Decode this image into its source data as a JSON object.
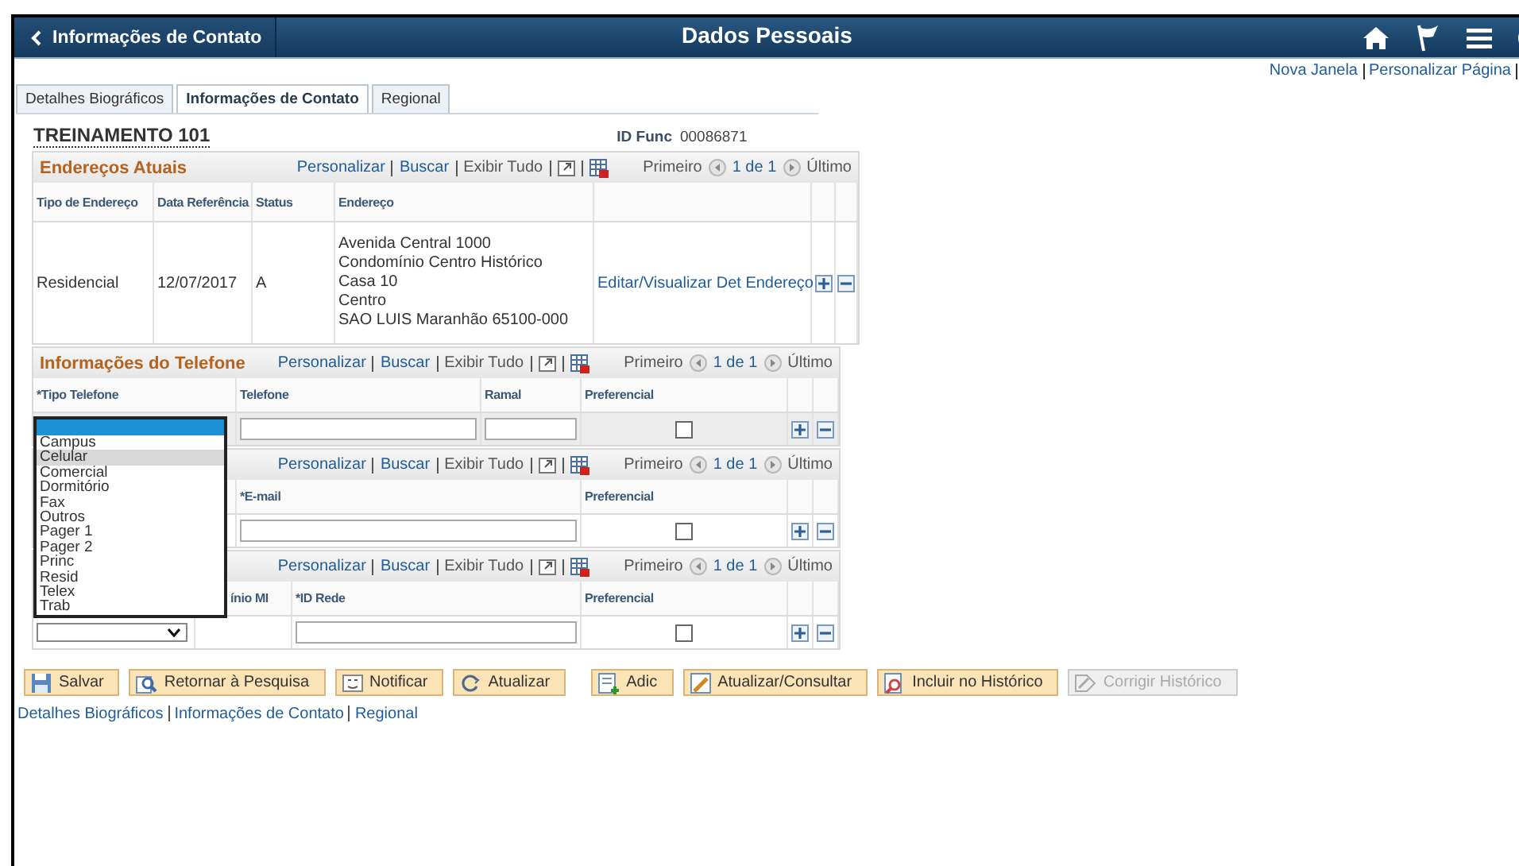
{
  "header": {
    "back_label": "Informações de Contato",
    "title": "Dados Pessoais"
  },
  "page_links": [
    "Nova Janela",
    "Personalizar Página"
  ],
  "tabs": [
    {
      "label": "Detalhes Biográficos",
      "selected": false
    },
    {
      "label": "Informações de Contato",
      "selected": true
    },
    {
      "label": "Regional",
      "selected": false
    }
  ],
  "employee": {
    "name": "TREINAMENTO 101",
    "id_label": "ID Func",
    "id_value": "00086871"
  },
  "sections": [
    {
      "title": "Endereços Atuais",
      "toolbar": {
        "customize": "Personalizar",
        "find": "Buscar",
        "view_all": "Exibir Tudo",
        "first": "Primeiro",
        "range": "1 de 1",
        "last": "Último"
      },
      "columns": [
        "Tipo de Endereço",
        "Data Referência",
        "Status",
        "Endereço"
      ],
      "rows": [
        {
          "highlighted": false,
          "cells": [
            {
              "kind": "text",
              "text": "Residencial"
            },
            {
              "kind": "text",
              "text": "12/07/2017"
            },
            {
              "kind": "text",
              "text": "A"
            },
            {
              "kind": "lines",
              "lines": [
                "Avenida Central 1000",
                "Condomínio Centro Histórico",
                "Casa 10",
                "Centro",
                "SAO LUIS Maranhão 65100-000"
              ]
            },
            {
              "kind": "link",
              "text": "Editar/Visualizar Det Endereço"
            },
            {
              "kind": "add"
            },
            {
              "kind": "remove"
            }
          ]
        }
      ]
    },
    {
      "title": "Informações do Telefone",
      "toolbar": {
        "customize": "Personalizar",
        "find": "Buscar",
        "view_all": "Exibir Tudo",
        "first": "Primeiro",
        "range": "1 de 1",
        "last": "Último"
      },
      "columns": [
        "*Tipo Telefone",
        "Telefone",
        "Ramal",
        "Preferencial"
      ],
      "rows": [
        {
          "highlighted": true,
          "cells": [
            {
              "kind": "select",
              "open": true,
              "blank_selected": true,
              "options": [
                {
                  "label": "Campus",
                  "highlighted": false
                },
                {
                  "label": "Celular",
                  "highlighted": true
                },
                {
                  "label": "Comercial",
                  "highlighted": false
                },
                {
                  "label": "Dormitório",
                  "highlighted": false
                },
                {
                  "label": "Fax",
                  "highlighted": false
                },
                {
                  "label": "Outros",
                  "highlighted": false
                },
                {
                  "label": "Pager 1",
                  "highlighted": false
                },
                {
                  "label": "Pager 2",
                  "highlighted": false
                },
                {
                  "label": "Princ",
                  "highlighted": false
                },
                {
                  "label": "Resid",
                  "highlighted": false
                },
                {
                  "label": "Telex",
                  "highlighted": false
                },
                {
                  "label": "Trab",
                  "highlighted": false
                }
              ]
            },
            {
              "kind": "input"
            },
            {
              "kind": "input"
            },
            {
              "kind": "checkbox",
              "checked": false
            },
            {
              "kind": "add"
            },
            {
              "kind": "remove"
            }
          ]
        }
      ]
    },
    {
      "toolbar": {
        "customize": "Personalizar",
        "find": "Buscar",
        "view_all": "Exibir Tudo",
        "first": "Primeiro",
        "range": "1 de 1",
        "last": "Último"
      },
      "columns": [
        "",
        "*E-mail",
        "Preferencial"
      ],
      "rows": [
        {
          "highlighted": false,
          "cells": [
            {
              "kind": "empty"
            },
            {
              "kind": "input"
            },
            {
              "kind": "checkbox",
              "checked": false
            },
            {
              "kind": "add"
            },
            {
              "kind": "remove"
            }
          ]
        }
      ]
    },
    {
      "toolbar": {
        "customize": "Personalizar",
        "find": "Buscar",
        "view_all": "Exibir Tudo",
        "first": "Primeiro",
        "range": "1 de 1",
        "last": "Último"
      },
      "columns": [
        "",
        "ínio MI",
        "*ID Rede",
        "Preferencial"
      ],
      "rows": [
        {
          "highlighted": false,
          "cells": [
            {
              "kind": "select",
              "open": false
            },
            {
              "kind": "empty"
            },
            {
              "kind": "input"
            },
            {
              "kind": "checkbox",
              "checked": false
            },
            {
              "kind": "add"
            },
            {
              "kind": "remove"
            }
          ]
        }
      ]
    }
  ],
  "buttons": [
    {
      "label": "Salvar",
      "disabled": false
    },
    {
      "label": "Retornar à Pesquisa",
      "disabled": false
    },
    {
      "label": "Notificar",
      "disabled": false
    },
    {
      "label": "Atualizar",
      "disabled": false
    },
    {
      "label": "Adic",
      "disabled": false
    },
    {
      "label": "Atualizar/Consultar",
      "disabled": false
    },
    {
      "label": "Incluir no Histórico",
      "disabled": false
    },
    {
      "label": "Corrigir Histórico",
      "disabled": true
    }
  ],
  "bottom_links": [
    "Detalhes Biográficos",
    "Informações de Contato",
    "Regional"
  ]
}
